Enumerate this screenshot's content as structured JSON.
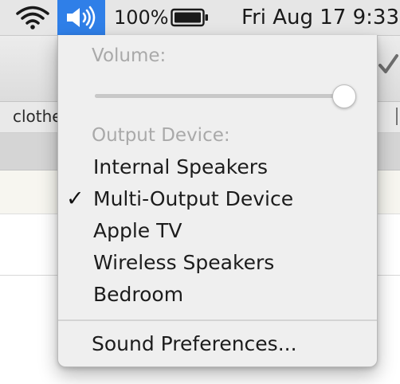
{
  "menubar": {
    "wifi_icon": "wifi-icon",
    "volume_icon": "speaker-volume-icon",
    "battery_percent": "100%",
    "battery_icon": "battery-full-icon",
    "datetime": "Fri Aug 17  9:33"
  },
  "background_window": {
    "tab_label": "clothe"
  },
  "volume_menu": {
    "volume_header": "Volume:",
    "volume_level": 1.0,
    "output_header": "Output Device:",
    "devices": [
      {
        "label": "Internal Speakers",
        "selected": false
      },
      {
        "label": "Multi-Output Device",
        "selected": true
      },
      {
        "label": "Apple TV",
        "selected": false
      },
      {
        "label": "Wireless Speakers",
        "selected": false
      },
      {
        "label": "Bedroom",
        "selected": false
      }
    ],
    "checkmark": "✓",
    "sound_prefs_label": "Sound Preferences..."
  },
  "colors": {
    "menubar_bg": "#e6e6e6",
    "volume_highlight": "#2f7fe8",
    "menu_bg": "#efefef",
    "disabled_text": "#a9a9a9"
  }
}
